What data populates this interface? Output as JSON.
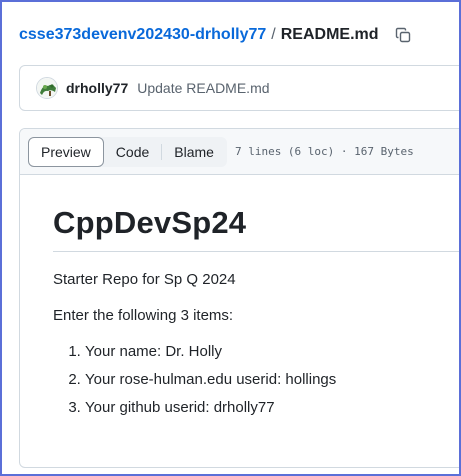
{
  "breadcrumb": {
    "repo": "csse373devenv202430-drholly77",
    "separator": "/",
    "file": "README.md"
  },
  "icons": {
    "copy": "copy-icon",
    "avatar": "user-avatar"
  },
  "commit": {
    "author": "drholly77",
    "message": "Update README.md"
  },
  "file_header": {
    "tabs": [
      "Preview",
      "Code",
      "Blame"
    ],
    "active_tab": "Preview",
    "meta": "7 lines (6 loc) · 167 Bytes"
  },
  "readme": {
    "title": "CppDevSp24",
    "paragraph1": "Starter Repo for Sp Q 2024",
    "paragraph2": "Enter the following 3 items:",
    "items": [
      "Your name: Dr. Holly",
      "Your rose-hulman.edu userid: hollings",
      "Your github userid: drholly77"
    ]
  },
  "colors": {
    "link": "#0969da",
    "frame": "#5b6fd8",
    "border": "#d1d9e0"
  }
}
